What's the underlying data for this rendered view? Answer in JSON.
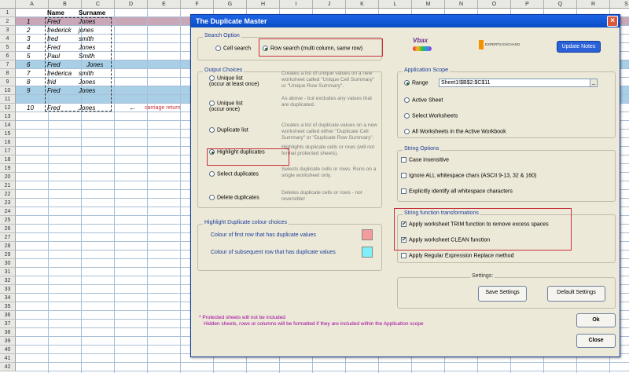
{
  "sheet": {
    "columns": [
      "A",
      "B",
      "C",
      "D",
      "E",
      "F",
      "G",
      "H",
      "I",
      "J",
      "K",
      "L",
      "M",
      "N",
      "O",
      "P",
      "Q",
      "R",
      "S"
    ],
    "rows": [
      "1",
      "2",
      "3",
      "4",
      "5",
      "6",
      "7",
      "8",
      "9",
      "10",
      "11",
      "12",
      "13",
      "14",
      "15",
      "16",
      "17",
      "18",
      "19",
      "20",
      "21",
      "22",
      "23",
      "24",
      "25",
      "26",
      "27",
      "28",
      "29",
      "30",
      "31",
      "32",
      "33",
      "34",
      "35",
      "36",
      "37",
      "38",
      "39",
      "40",
      "41",
      "42"
    ],
    "header_name": "Name",
    "header_surname": "Surname",
    "data": [
      {
        "num": "1",
        "name": "Fred",
        "surname": "Jones"
      },
      {
        "num": "2",
        "name": "frederick",
        "surname": "jones"
      },
      {
        "num": "3",
        "name": "fred",
        "surname": "smith"
      },
      {
        "num": "4",
        "name": "Fred",
        "surname": "Jones"
      },
      {
        "num": "5",
        "name": "Paul",
        "surname": "Smith"
      },
      {
        "num": "6",
        "name": "Fred",
        "surname": "Jones"
      },
      {
        "num": "7",
        "name": "frederica",
        "surname": "smith"
      },
      {
        "num": "8",
        "name": "frid",
        "surname": "Jones"
      },
      {
        "num": "9",
        "name": "Fred",
        "surname": "Jones"
      },
      {
        "num": "10",
        "name": "Fred",
        "surname": "Jones"
      }
    ],
    "arrow": "←",
    "carriage_note": "carriage return"
  },
  "dialog": {
    "title": "The Duplicate Master",
    "close": "×",
    "logo_text": "Vbax",
    "logo2_text": "EXPERTS EXCHANGE",
    "update_notes": "Update Notes",
    "search_option": {
      "title": "Search Option",
      "cell_search": "Cell search",
      "row_search": "Row search (multi column, same row)"
    },
    "output_choices": {
      "title": "Output Choices",
      "items": [
        {
          "label": "Unique list\n(occur at least once)",
          "desc": "Creates a list of unique values on a new worksheet called \"Unique Cell Summary\" or \"Unique Row Summary\"."
        },
        {
          "label": "Unique list\n(occur once)",
          "desc": "As above - but excludes any values that are duplicated."
        },
        {
          "label": "Duplicate list",
          "desc": "Creates a list of duplicate values on a new worksheet called either \"Duplicate Cell Summary\" or \"Duplicate Row Summary\"."
        },
        {
          "label": "Highlight duplicates",
          "desc": "Highlights duplicate cells or rows (will not format protected sheets)."
        },
        {
          "label": "Select duplicates",
          "desc": "Selects duplicate cells or rows. Runs on a single worksheet only."
        },
        {
          "label": "Delete duplicates",
          "desc": "Deletes duplicate cells or rows - not reversible!"
        }
      ]
    },
    "highlight_colours": {
      "title": "Highlight Duplicate colour choices",
      "first_row": "Colour of first row that has duplicate values",
      "subsequent_row": "Colour of subsequent row that has duplicate values",
      "first_color": "#f39c9c",
      "second_color": "#80f0f8"
    },
    "application_scope": {
      "title": "Application Scope",
      "range": "Range",
      "range_value": "Sheet1!$B$2:$C$11",
      "active_sheet": "Active Sheet",
      "select_worksheets": "Select Worksheets",
      "all_worksheets": "All Worksheets in the Active Workbook"
    },
    "string_options": {
      "title": "String Options",
      "case_insensitive": "Case insensitive",
      "ignore_whitespace": "Ignore ALL whitespace chars (ASCII 9-13, 32 & 160)",
      "explicit_whitespace": "Explicitly identify all whitespace characters"
    },
    "string_functions": {
      "title": "String function transformations",
      "trim": "Apply worksheet TRIM function to remove excess spaces",
      "clean": "Apply worksheet CLEAN function",
      "regex": "Apply Regular Expression Replace method"
    },
    "settings": {
      "title": "Settings:",
      "save": "Save Settings",
      "default": "Default Settings"
    },
    "notes": [
      "* Protected sheets will not be included",
      "Hidden sheets, rows or columns will be formatted if they are included within the Application scope"
    ],
    "ok": "Ok",
    "close_btn": "Close"
  }
}
